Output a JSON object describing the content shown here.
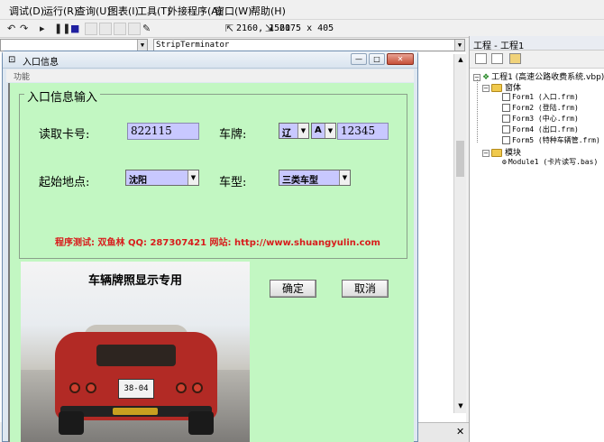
{
  "menubar": {
    "items": [
      "调试(D)",
      "运行(R)",
      "查询(U)",
      "图表(I)",
      "工具(T)",
      "外接程序(A)",
      "窗口(W)",
      "帮助(H)"
    ]
  },
  "toolbar": {
    "position": "2160, 1560",
    "size": "2175 x 405"
  },
  "object_combo": {
    "value": "",
    "procedure": "StripTerminator"
  },
  "project_panel": {
    "title": "工程 - 工程1",
    "root": "工程1 (高速公路收费系统.vbp)",
    "forms_folder": "窗体",
    "forms": [
      "Form1 (入口.frm)",
      "Form2 (登陆.frm)",
      "Form3 (中心.frm)",
      "Form4 (出口.frm)",
      "Form5 (特种车辆管.frm)"
    ],
    "modules_folder": "模块",
    "modules": [
      "Module1 (卡片读写.bas)"
    ]
  },
  "dialog": {
    "title": "入口信息",
    "menu": "功能",
    "frame_title": "入口信息输入",
    "card_label": "读取卡号:",
    "card_value": "822115",
    "plate_label": "车牌:",
    "plate_province": "辽",
    "plate_letter": "A",
    "plate_number": "12345",
    "origin_label": "起始地点:",
    "origin_value": "沈阳",
    "type_label": "车型:",
    "type_value": "三类车型",
    "info": "程序测试: 双鱼林  QQ: 287307421  网站: http://www.shuangyulin.com",
    "ok": "确定",
    "cancel": "取消",
    "photo_caption": "车辆牌照显示专用",
    "plate_photo_text": "38-04"
  },
  "colors": {
    "client_bg": "#c2f7c2",
    "field_bg": "#c8c8ff",
    "info_text": "#d81c1c"
  }
}
